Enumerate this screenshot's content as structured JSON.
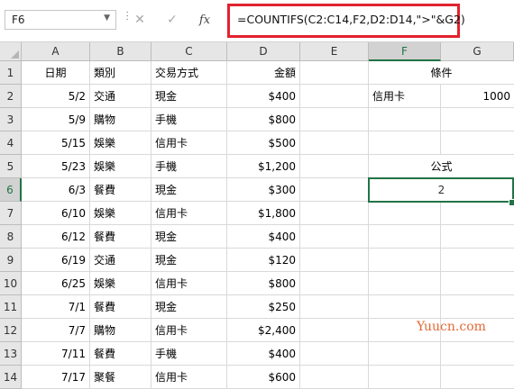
{
  "name_box": {
    "value": "F6"
  },
  "formula_bar": {
    "cancel_glyph": "✕",
    "enter_glyph": "✓",
    "fx_label": "fx",
    "formula": "=COUNTIFS(C2:C14,F2,D2:D14,\">\"&G2)"
  },
  "grid": {
    "columns": [
      "A",
      "B",
      "C",
      "D",
      "E",
      "F",
      "G"
    ],
    "rows": [
      "1",
      "2",
      "3",
      "4",
      "5",
      "6",
      "7",
      "8",
      "9",
      "10",
      "11",
      "12",
      "13",
      "14"
    ],
    "selected_cell": "F6",
    "header_row": {
      "date": "日期",
      "category": "類別",
      "payment": "交易方式",
      "amount": "金額"
    },
    "records": [
      {
        "date": "5/2",
        "category": "交通",
        "payment": "現金",
        "amount": "$400"
      },
      {
        "date": "5/9",
        "category": "購物",
        "payment": "手機",
        "amount": "$800"
      },
      {
        "date": "5/15",
        "category": "娛樂",
        "payment": "信用卡",
        "amount": "$500"
      },
      {
        "date": "5/23",
        "category": "娛樂",
        "payment": "手機",
        "amount": "$1,200"
      },
      {
        "date": "6/3",
        "category": "餐費",
        "payment": "現金",
        "amount": "$300"
      },
      {
        "date": "6/10",
        "category": "娛樂",
        "payment": "信用卡",
        "amount": "$1,800"
      },
      {
        "date": "6/12",
        "category": "餐費",
        "payment": "現金",
        "amount": "$400"
      },
      {
        "date": "6/19",
        "category": "交通",
        "payment": "現金",
        "amount": "$120"
      },
      {
        "date": "6/25",
        "category": "娛樂",
        "payment": "信用卡",
        "amount": "$800"
      },
      {
        "date": "7/1",
        "category": "餐費",
        "payment": "現金",
        "amount": "$250"
      },
      {
        "date": "7/7",
        "category": "購物",
        "payment": "信用卡",
        "amount": "$2,400"
      },
      {
        "date": "7/11",
        "category": "餐費",
        "payment": "手機",
        "amount": "$400"
      },
      {
        "date": "7/17",
        "category": "聚餐",
        "payment": "信用卡",
        "amount": "$600"
      }
    ],
    "side": {
      "conditions_label": "條件",
      "condition_payment": "信用卡",
      "condition_amount": "1000",
      "formula_label": "公式",
      "result": "2"
    }
  },
  "colors": {
    "accent": "#217346",
    "highlight_border": "#e2222e",
    "watermark": "#e06a36"
  },
  "watermark": "Yuucn.com"
}
